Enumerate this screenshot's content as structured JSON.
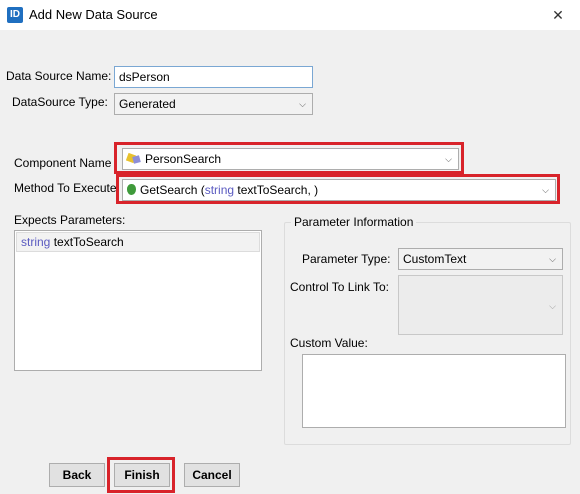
{
  "window": {
    "icon_text": "ID",
    "title": "Add New Data Source",
    "close_glyph": "✕"
  },
  "form": {
    "datasource_name_label": "Data Source Name:",
    "datasource_name_value": "dsPerson",
    "datasource_type_label": "DataSource Type:",
    "datasource_type_value": "Generated",
    "component_name_label": "Component Name",
    "component_name_value": "PersonSearch",
    "method_label": "Method To Execute",
    "method_name": "GetSearch",
    "method_open": "(",
    "method_param_type": "string",
    "method_param_rest": "textToSearch, )",
    "expects_parameters_label": "Expects Parameters:",
    "parameters": [
      {
        "type": "string",
        "name": "textToSearch"
      }
    ]
  },
  "parameter_info": {
    "group_title": "Parameter Information",
    "parameter_type_label": "Parameter Type:",
    "parameter_type_value": "CustomText",
    "control_link_label": "Control To Link To:",
    "control_link_value": "",
    "custom_value_label": "Custom Value:",
    "custom_value": ""
  },
  "buttons": {
    "back": "Back",
    "finish": "Finish",
    "cancel": "Cancel"
  },
  "icons": {
    "dropdown": "chevron-down-icon",
    "component": "component-icon",
    "method": "method-icon"
  },
  "colors": {
    "highlight": "#d8232a",
    "keyword": "#5a5ac0",
    "app_icon": "#1f6fc0"
  }
}
